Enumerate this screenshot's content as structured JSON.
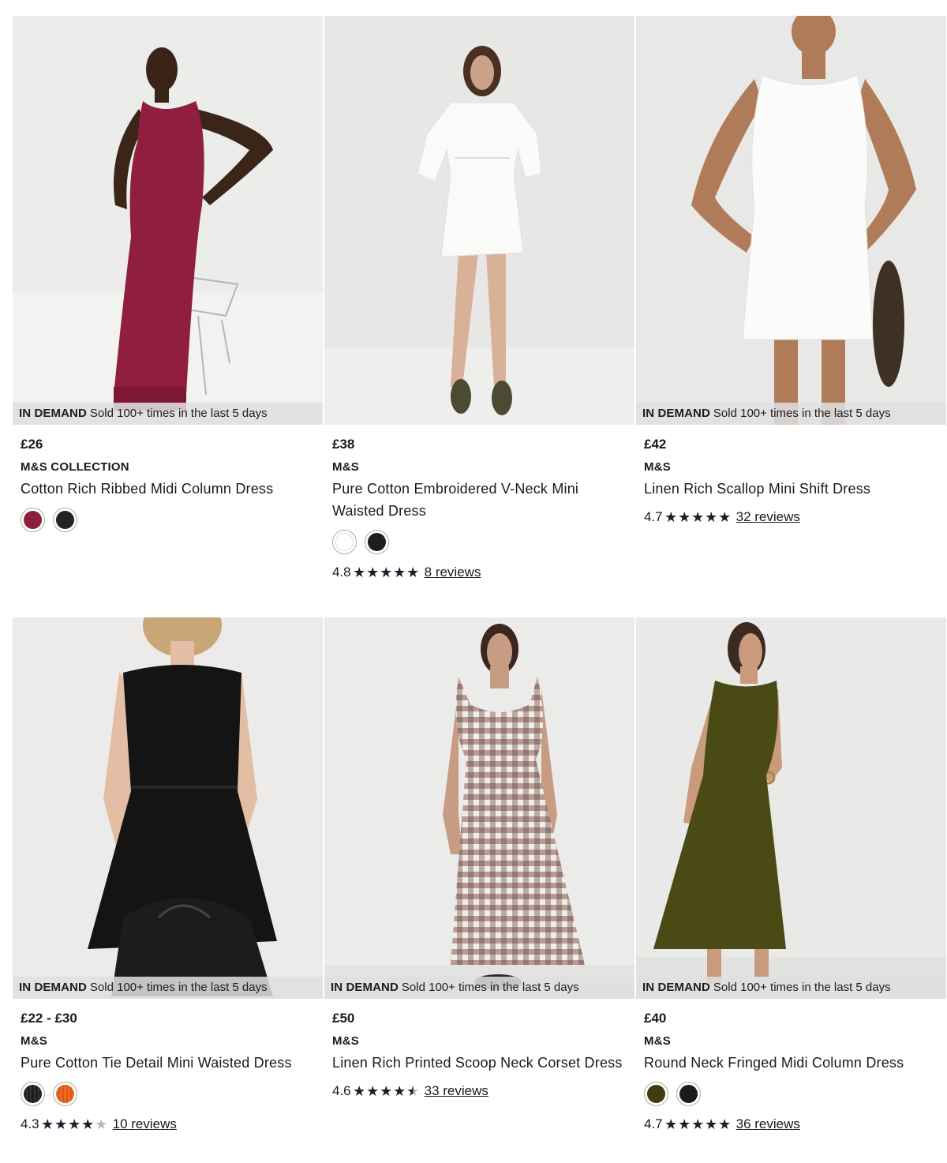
{
  "badge": {
    "strong": "IN DEMAND",
    "text": "Sold 100+ times in the last 5 days"
  },
  "products": [
    {
      "price": "£26",
      "brand": "M&S COLLECTION",
      "title": "Cotton Rich Ribbed Midi Column Dress",
      "in_demand": true,
      "swatches": [
        "#8c1f3d",
        "#232323"
      ],
      "rating": null,
      "reviews": null,
      "dress_color": "#8f1e3f",
      "background": "#eaeaea"
    },
    {
      "price": "£38",
      "brand": "M&S",
      "title": "Pure Cotton Embroidered V-Neck Mini Waisted Dress",
      "in_demand": false,
      "swatches": [
        "#ffffff",
        "#1d1d1d"
      ],
      "rating": "4.8",
      "stars": 5,
      "reviews": "8 reviews",
      "dress_color": "#f8f8f6",
      "background": "#e7e7e5"
    },
    {
      "price": "£42",
      "brand": "M&S",
      "title": "Linen Rich Scallop Mini Shift Dress",
      "in_demand": true,
      "swatches": [],
      "rating": "4.7",
      "stars": 5,
      "reviews": "32 reviews",
      "dress_color": "#fbfbfa",
      "background": "#e8e8e6"
    },
    {
      "price": "£22 - £30",
      "brand": "M&S",
      "title": "Pure Cotton Tie Detail Mini Waisted Dress",
      "in_demand": true,
      "swatches": [
        "#1e1e1e",
        "#f06a1c"
      ],
      "rating": "4.3",
      "stars": 4,
      "half": false,
      "reviews": "10 reviews",
      "dress_color": "#141414",
      "background": "#ecebea"
    },
    {
      "price": "£50",
      "brand": "M&S",
      "title": "Linen Rich Printed Scoop Neck Corset Dress",
      "in_demand": true,
      "swatches": [],
      "rating": "4.6",
      "stars": 4,
      "half": true,
      "reviews": "33 reviews",
      "dress_color": "#e9e2d8",
      "background": "#ebebea"
    },
    {
      "price": "£40",
      "brand": "M&S",
      "title": "Round Neck Fringed Midi Column Dress",
      "in_demand": true,
      "swatches": [
        "#3f3c12",
        "#1a1a1a"
      ],
      "rating": "4.7",
      "stars": 5,
      "reviews": "36 reviews",
      "dress_color": "#4a4a14",
      "background": "#e9e9e8"
    }
  ]
}
